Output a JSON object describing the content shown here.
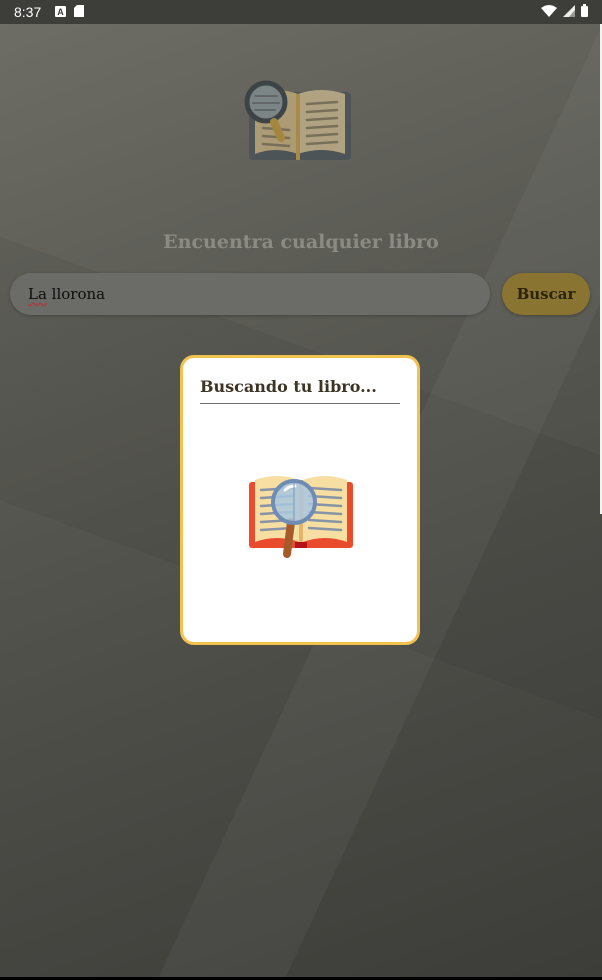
{
  "status_bar": {
    "time": "8:37",
    "left_icons": [
      "a-notification-icon",
      "sd-card-icon"
    ],
    "right_icons": [
      "wifi-icon",
      "signal-icon",
      "battery-icon"
    ]
  },
  "header": {
    "title": "Encuentra cualquier libro",
    "logo_icon": "book-search-icon"
  },
  "search": {
    "value_prefix": "La",
    "value_rest": " llorona",
    "button_label": "Buscar"
  },
  "dialog": {
    "title": "Buscando tu libro...",
    "illustration_icon": "book-magnifier-icon"
  },
  "colors": {
    "accent": "#f2c24f",
    "button": "#8a7432",
    "background": "#55554f"
  }
}
